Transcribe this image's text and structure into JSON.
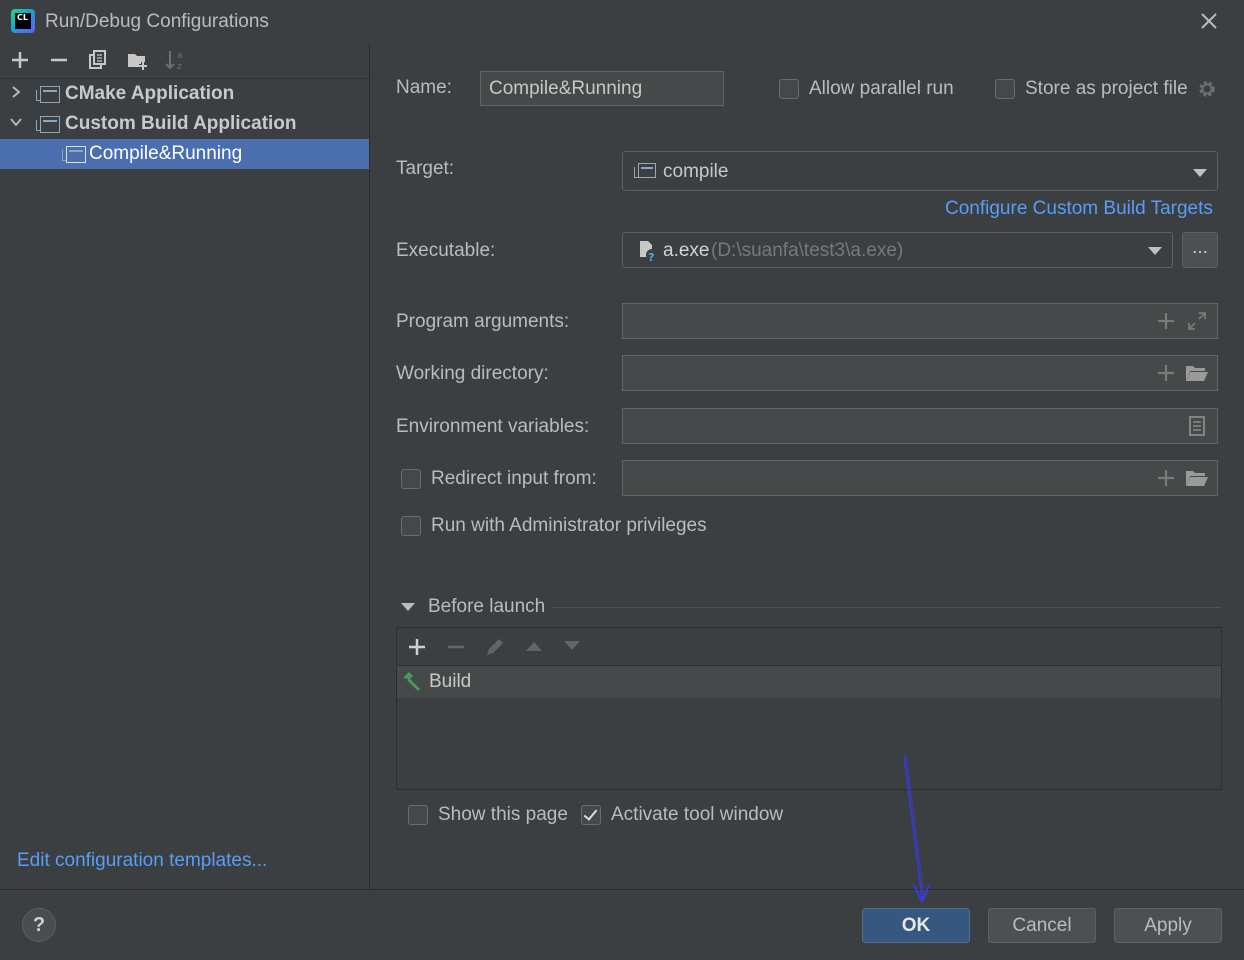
{
  "window": {
    "title": "Run/Debug Configurations",
    "logo_text": "CL"
  },
  "toolbar": {
    "icons": [
      "add-icon",
      "remove-icon",
      "copy-icon",
      "folder-add-icon",
      "sort-icon"
    ]
  },
  "tree": {
    "items": [
      {
        "label": "CMake Application",
        "expanded": false
      },
      {
        "label": "Custom Build Application",
        "expanded": true
      },
      {
        "label": "Compile&Running",
        "selected": true
      }
    ]
  },
  "edit_templates_link": "Edit configuration templates...",
  "form": {
    "name_label": "Name:",
    "name_value": "Compile&Running",
    "allow_parallel_label": "Allow parallel run",
    "allow_parallel_checked": false,
    "store_project_label": "Store as project file",
    "store_project_checked": false,
    "target_label": "Target:",
    "target_value": "compile",
    "configure_link": "Configure Custom Build Targets",
    "executable_label": "Executable:",
    "executable_value": "a.exe",
    "executable_path": "(D:\\suanfa\\test3\\a.exe)",
    "browse_label": "...",
    "program_args_label": "Program arguments:",
    "working_dir_label": "Working directory:",
    "env_vars_label": "Environment variables:",
    "redirect_label": "Redirect input from:",
    "redirect_checked": false,
    "admin_label": "Run with Administrator privileges",
    "admin_checked": false
  },
  "before_launch": {
    "title": "Before launch",
    "tasks": [
      {
        "label": "Build"
      }
    ],
    "show_page_label": "Show this page",
    "show_page_checked": false,
    "activate_label": "Activate tool window",
    "activate_checked": true
  },
  "buttons": {
    "help": "?",
    "ok": "OK",
    "cancel": "Cancel",
    "apply": "Apply"
  },
  "colors": {
    "accent": "#4b6eaf",
    "link": "#589df6",
    "background": "#3c3f41",
    "annotation_arrow": "#3a3ad8"
  }
}
